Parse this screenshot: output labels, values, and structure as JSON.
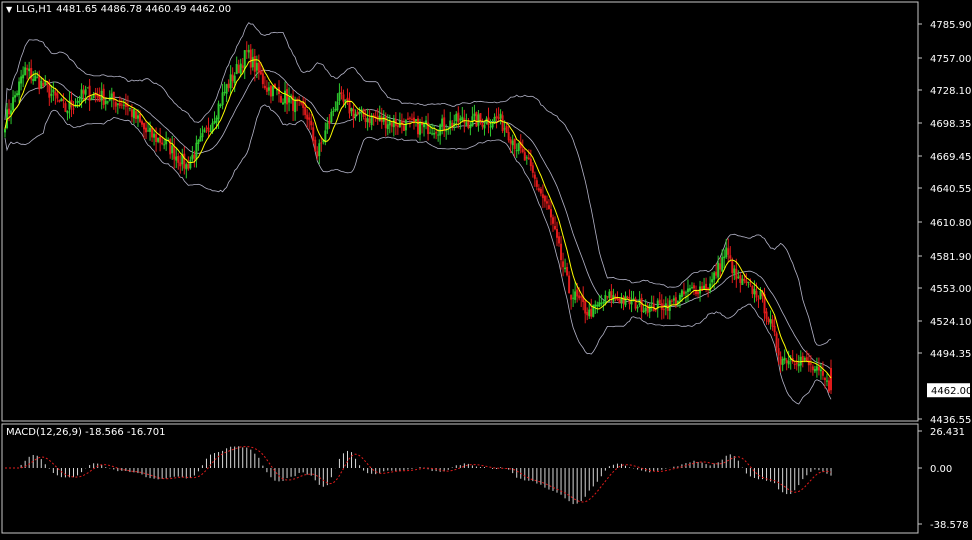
{
  "header": {
    "menu_icon": "triangle-down-icon",
    "symbol": "LLG,H1",
    "ohlc": "4481.65 4486.78 4460.49 4462.00"
  },
  "macd_header": {
    "label": "MACD(12,26,9)",
    "values": "-18.566 -16.701"
  },
  "colors": {
    "background": "#000000",
    "bull": "#2ec92e",
    "bear": "#e01b1b",
    "ma": "#ffff00",
    "bands": "#b4b4c8",
    "macd_hist": "#d8d8d8",
    "signal": "#e01b1b",
    "grid_text": "#ffffff",
    "frame": "#c8c8c8"
  },
  "chart_data": [
    {
      "type": "candlestick",
      "name": "price",
      "ylim": [
        4436.55,
        4800.0
      ],
      "y_ticks": [
        "4785.90",
        "4757.00",
        "4728.10",
        "4698.35",
        "4669.45",
        "4640.55",
        "4610.80",
        "4581.90",
        "4553.00",
        "4524.10",
        "4494.35",
        "4436.55"
      ],
      "current_price": "4462.00",
      "grid": false,
      "overlays": [
        "Bollinger Bands (upper, middle, lower)",
        "moving average (yellow)"
      ],
      "keypoints_close": [
        [
          0,
          4700
        ],
        [
          10,
          4745
        ],
        [
          20,
          4730
        ],
        [
          30,
          4710
        ],
        [
          40,
          4725
        ],
        [
          50,
          4720
        ],
        [
          60,
          4715
        ],
        [
          70,
          4690
        ],
        [
          80,
          4680
        ],
        [
          90,
          4660
        ],
        [
          100,
          4690
        ],
        [
          110,
          4730
        ],
        [
          120,
          4760
        ],
        [
          130,
          4730
        ],
        [
          140,
          4720
        ],
        [
          150,
          4705
        ],
        [
          155,
          4670
        ],
        [
          165,
          4720
        ],
        [
          175,
          4705
        ],
        [
          190,
          4700
        ],
        [
          205,
          4695
        ],
        [
          215,
          4695
        ],
        [
          225,
          4700
        ],
        [
          235,
          4700
        ],
        [
          245,
          4702
        ],
        [
          250,
          4690
        ],
        [
          260,
          4660
        ],
        [
          270,
          4620
        ],
        [
          280,
          4550
        ],
        [
          290,
          4530
        ],
        [
          300,
          4545
        ],
        [
          310,
          4540
        ],
        [
          320,
          4535
        ],
        [
          330,
          4538
        ],
        [
          340,
          4550
        ],
        [
          350,
          4555
        ],
        [
          358,
          4585
        ],
        [
          363,
          4560
        ],
        [
          370,
          4552
        ],
        [
          375,
          4545
        ],
        [
          380,
          4520
        ],
        [
          385,
          4490
        ],
        [
          395,
          4490
        ],
        [
          405,
          4475
        ],
        [
          410,
          4462
        ]
      ],
      "candle_count": 411,
      "last_candle": {
        "open": 4481.65,
        "high": 4486.78,
        "low": 4460.49,
        "close": 4462.0
      }
    },
    {
      "type": "bar",
      "name": "MACD",
      "title": "MACD(12,26,9)",
      "ylim": [
        -38.578,
        26.431
      ],
      "y_ticks": [
        "26.431",
        "0.00",
        "-38.578"
      ],
      "macd_last": -18.566,
      "signal_last": -16.701,
      "histogram_color": "#d8d8d8",
      "signal_color": "#e01b1b",
      "signal_style": "dotted"
    }
  ]
}
